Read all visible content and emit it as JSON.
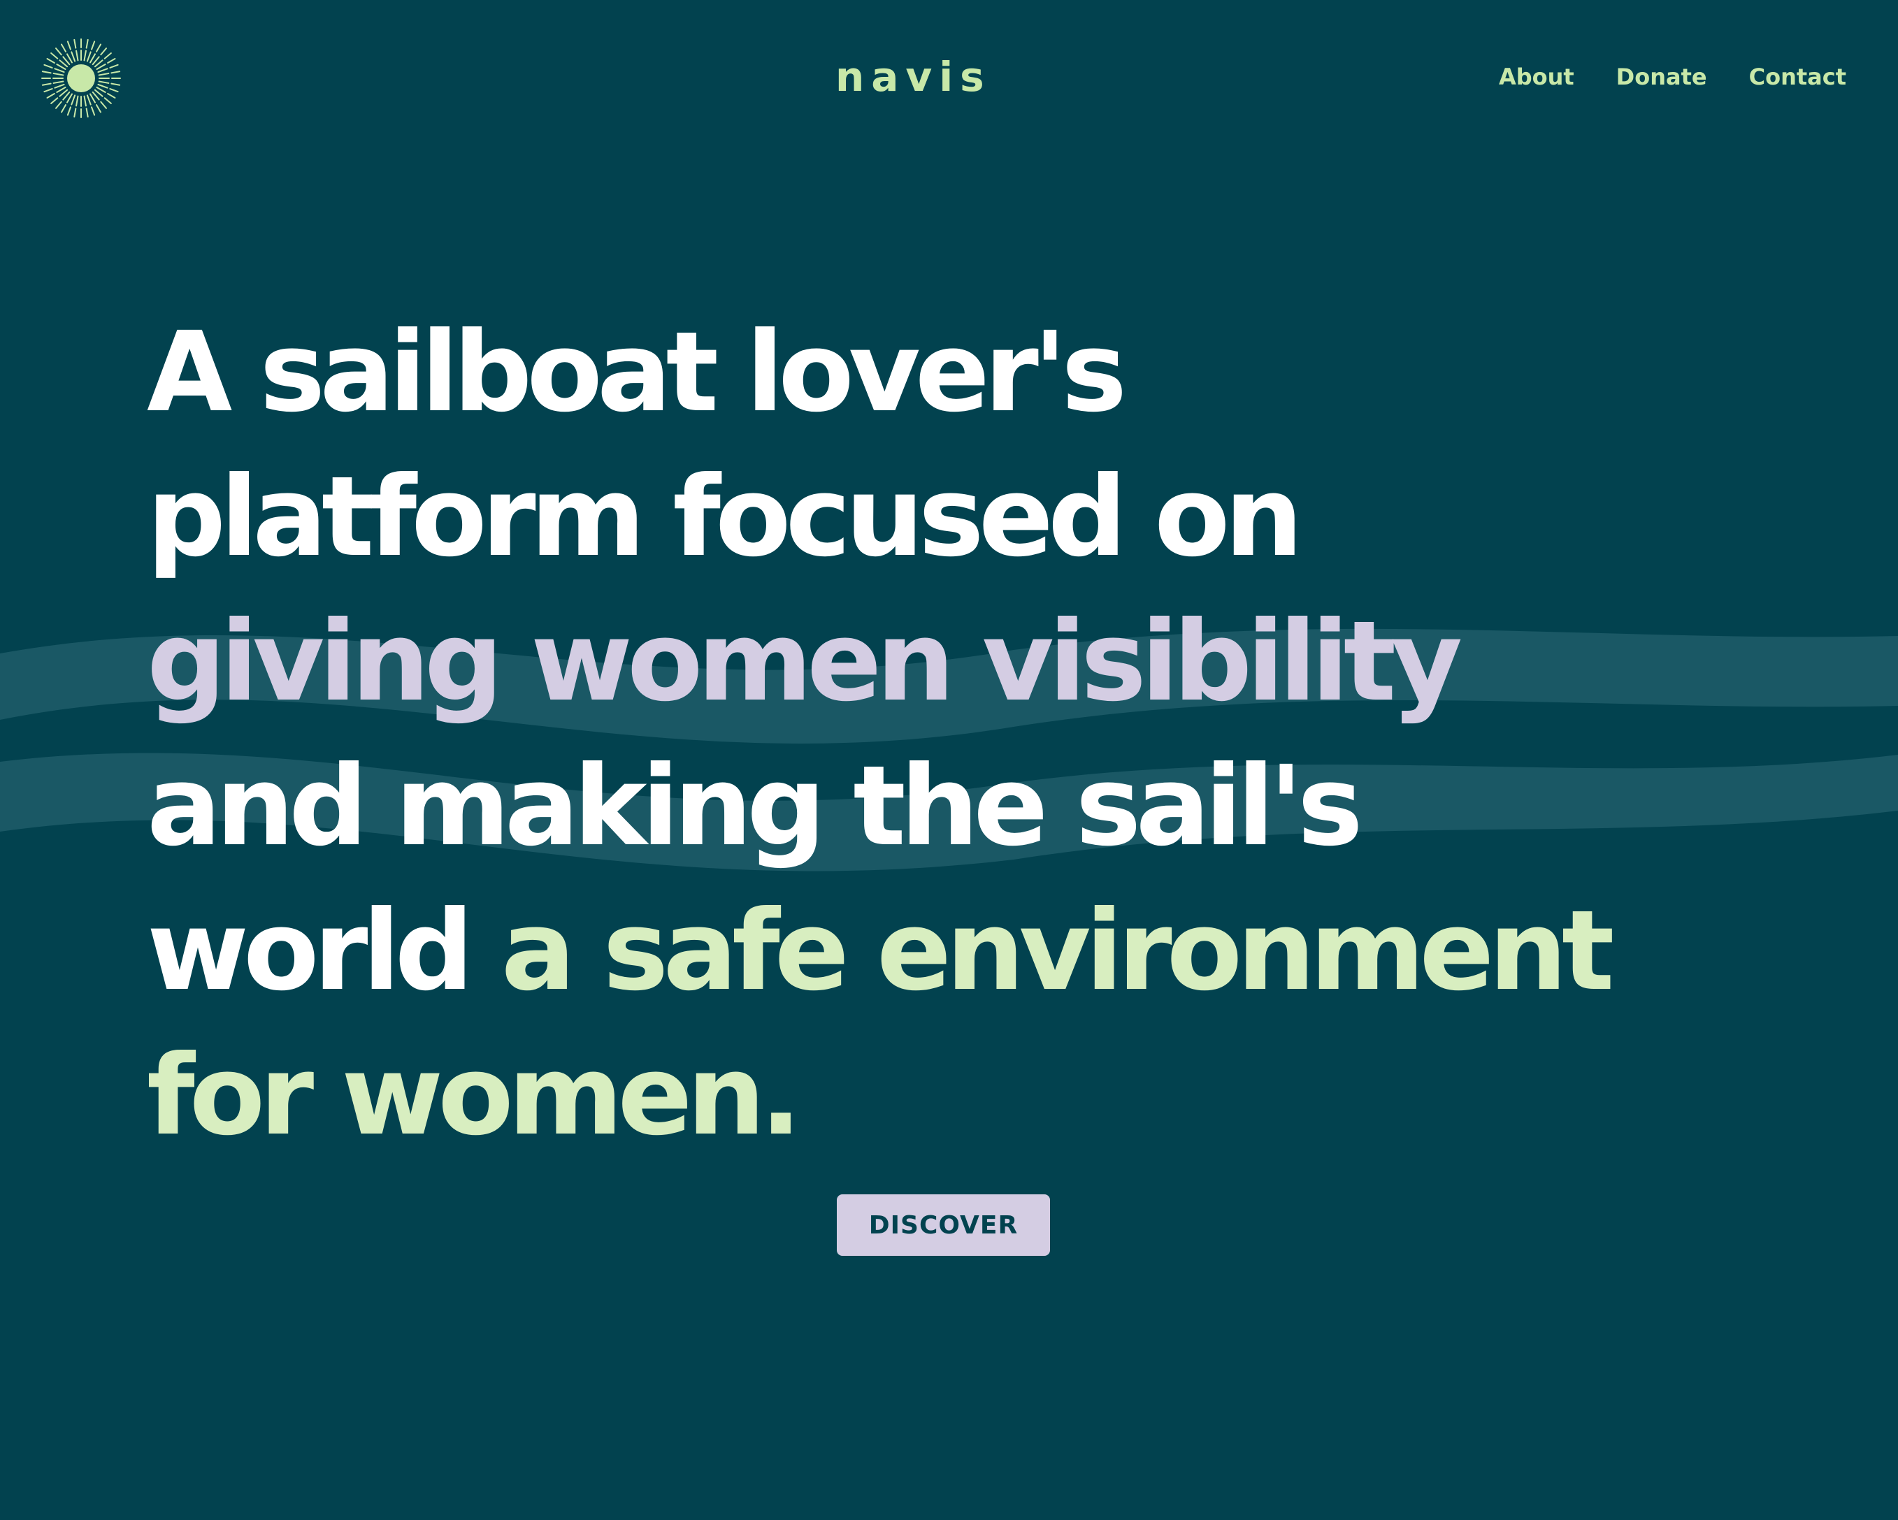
{
  "header": {
    "brand": "navis",
    "logo_icon": "sun-burst-icon",
    "nav": [
      {
        "label": "About"
      },
      {
        "label": "Donate"
      },
      {
        "label": "Contact"
      }
    ]
  },
  "hero": {
    "line1": "A sailboat lover's",
    "line2": "platform focused on",
    "line3": "giving women visibility",
    "line4": "and making the sail's",
    "line5_plain": "world",
    "line5_accent": "a safe environment",
    "line6": "for women.",
    "cta_label": "DISCOVER"
  },
  "colors": {
    "background": "#02424f",
    "heading": "#ffffff",
    "accent_lavender": "#d4cde3",
    "accent_mint": "#d8eec0",
    "nav": "#c8e8a8",
    "wave": "#1f5c69"
  }
}
